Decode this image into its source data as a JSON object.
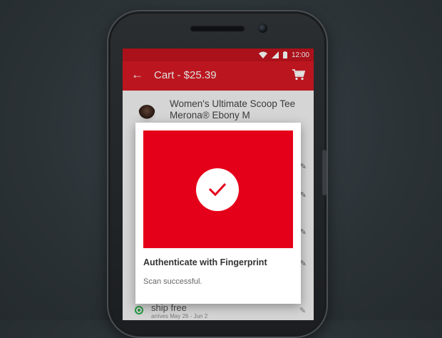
{
  "status_bar": {
    "time": "12:00"
  },
  "app_bar": {
    "back_icon": "arrow-back-icon",
    "title": "Cart - $25.39",
    "cart_icon": "shopping-cart-icon"
  },
  "cart_item": {
    "name_line1": "Women's Ultimate Scoop Tee",
    "name_line2": "Merona® Ebony M"
  },
  "shipping": {
    "label": "ship free",
    "arrival": "arrives May 26 - Jun 2",
    "selected": true
  },
  "dialog": {
    "title": "Authenticate with Fingerprint",
    "message": "Scan successful.",
    "status_icon": "checkmark-icon",
    "accent_color": "#e50019"
  },
  "colors": {
    "app_bar": "#d51a24",
    "status_bar": "#c2141e",
    "radio_selected": "#2bb14b"
  }
}
